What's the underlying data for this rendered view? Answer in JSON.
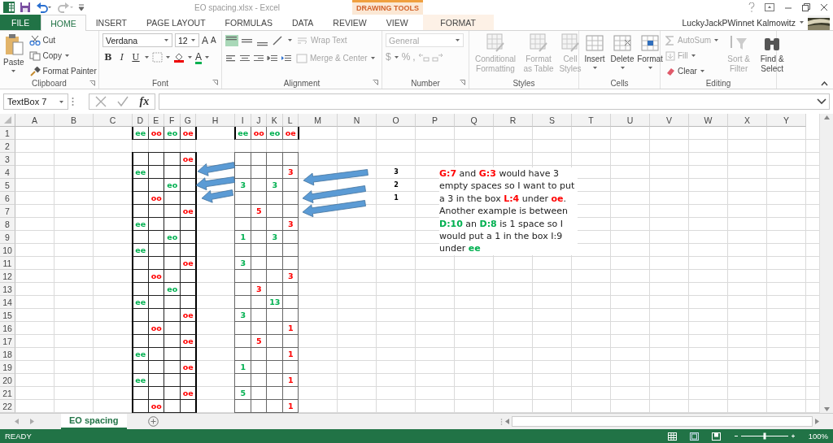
{
  "title_bar": {
    "title": "EO spacing.xlsx - Excel",
    "context_label": "DRAWING TOOLS"
  },
  "tabs": [
    {
      "label": "FILE",
      "kind": "file",
      "selected": false
    },
    {
      "label": "HOME",
      "kind": "normal",
      "selected": true
    },
    {
      "label": "INSERT",
      "kind": "normal",
      "selected": false
    },
    {
      "label": "PAGE LAYOUT",
      "kind": "normal",
      "selected": false
    },
    {
      "label": "FORMULAS",
      "kind": "normal",
      "selected": false
    },
    {
      "label": "DATA",
      "kind": "normal",
      "selected": false
    },
    {
      "label": "REVIEW",
      "kind": "normal",
      "selected": false
    },
    {
      "label": "VIEW",
      "kind": "normal",
      "selected": false
    },
    {
      "label": "FORMAT",
      "kind": "context",
      "selected": false
    }
  ],
  "user": {
    "name": "LuckyJackPWinnet Kalmowitz"
  },
  "ribbon": {
    "groups": [
      {
        "kind": "clipboard",
        "label": "Clipboard",
        "items": [
          {
            "label": "Paste"
          },
          {
            "label": "Cut"
          },
          {
            "label": "Copy"
          },
          {
            "label": "Format Painter"
          }
        ]
      },
      {
        "kind": "font",
        "label": "Font",
        "font": "Verdana",
        "size": "12",
        "size_buttons": [
          "A",
          "A"
        ],
        "styles": [
          "B",
          "I",
          "U"
        ],
        "font_color_label": "A"
      },
      {
        "kind": "alignment",
        "label": "Alignment",
        "items": [
          {
            "label": "Wrap Text",
            "disabled": true
          },
          {
            "label": "Merge & Center",
            "disabled": true
          }
        ]
      },
      {
        "kind": "number",
        "label": "Number",
        "format": "General",
        "symbols": [
          "$",
          "%",
          ","
        ],
        "disabled": true
      },
      {
        "kind": "styles",
        "label": "Styles",
        "items": [
          {
            "label": "Conditional Formatting",
            "disabled": true
          },
          {
            "label": "Format as Table",
            "disabled": true
          },
          {
            "label": "Cell Styles",
            "disabled": true
          }
        ]
      },
      {
        "kind": "cells",
        "label": "Cells",
        "items": [
          {
            "label": "Insert",
            "disabled": false
          },
          {
            "label": "Delete",
            "disabled": false
          },
          {
            "label": "Format",
            "disabled": false
          }
        ]
      },
      {
        "kind": "editing",
        "label": "Editing",
        "items": [
          {
            "label": "AutoSum",
            "disabled": true
          },
          {
            "label": "Fill",
            "disabled": true
          },
          {
            "label": "Clear",
            "disabled": false
          },
          {
            "label": "Sort & Filter",
            "disabled": true
          },
          {
            "label": "Find & Select",
            "disabled": false
          }
        ]
      }
    ]
  },
  "formula_bar": {
    "name_box": "TextBox 7",
    "function_label": "fx"
  },
  "sheet": {
    "columns": [
      "A",
      "B",
      "C",
      "D",
      "E",
      "F",
      "G",
      "H",
      "I",
      "J",
      "K",
      "L",
      "M",
      "N",
      "O",
      "P",
      "Q",
      "R",
      "S",
      "T",
      "U",
      "V",
      "W",
      "X",
      "Y"
    ],
    "rows": [
      {
        "number": "1",
        "cells": {
          "D": {
            "text": "ee",
            "color": "#00b050"
          },
          "E": {
            "text": "oo",
            "color": "#ff0000"
          },
          "F": {
            "text": "eo",
            "color": "#00b050"
          },
          "G": {
            "text": "oe",
            "color": "#ff0000"
          },
          "I": {
            "text": "ee",
            "color": "#00b050"
          },
          "J": {
            "text": "oo",
            "color": "#ff0000"
          },
          "K": {
            "text": "eo",
            "color": "#00b050"
          },
          "L": {
            "text": "oe",
            "color": "#ff0000"
          }
        }
      },
      {
        "number": "2",
        "cells": {}
      },
      {
        "number": "3",
        "cells": {
          "G": {
            "text": "oe",
            "color": "#ff0000"
          }
        }
      },
      {
        "number": "4",
        "cells": {
          "D": {
            "text": "ee",
            "color": "#00b050"
          },
          "L": {
            "text": "3",
            "color": "#ff0000"
          },
          "O": {
            "text": "3",
            "color": "#000000"
          }
        }
      },
      {
        "number": "5",
        "cells": {
          "F": {
            "text": "eo",
            "color": "#00b050"
          },
          "I": {
            "text": "3",
            "color": "#00b050"
          },
          "K": {
            "text": "3",
            "color": "#00b050"
          },
          "O": {
            "text": "2",
            "color": "#000000"
          }
        }
      },
      {
        "number": "6",
        "cells": {
          "E": {
            "text": "oo",
            "color": "#ff0000"
          },
          "O": {
            "text": "1",
            "color": "#000000"
          }
        }
      },
      {
        "number": "7",
        "cells": {
          "G": {
            "text": "oe",
            "color": "#ff0000"
          },
          "J": {
            "text": "5",
            "color": "#ff0000"
          }
        }
      },
      {
        "number": "8",
        "cells": {
          "D": {
            "text": "ee",
            "color": "#00b050"
          },
          "L": {
            "text": "3",
            "color": "#ff0000"
          }
        }
      },
      {
        "number": "9",
        "cells": {
          "F": {
            "text": "eo",
            "color": "#00b050"
          },
          "I": {
            "text": "1",
            "color": "#00b050"
          },
          "K": {
            "text": "3",
            "color": "#00b050"
          }
        }
      },
      {
        "number": "10",
        "cells": {
          "D": {
            "text": "ee",
            "color": "#00b050"
          }
        }
      },
      {
        "number": "11",
        "cells": {
          "G": {
            "text": "oe",
            "color": "#ff0000"
          },
          "I": {
            "text": "3",
            "color": "#00b050"
          }
        }
      },
      {
        "number": "12",
        "cells": {
          "E": {
            "text": "oo",
            "color": "#ff0000"
          },
          "L": {
            "text": "3",
            "color": "#ff0000"
          }
        }
      },
      {
        "number": "13",
        "cells": {
          "F": {
            "text": "eo",
            "color": "#00b050"
          },
          "J": {
            "text": "3",
            "color": "#ff0000"
          }
        }
      },
      {
        "number": "14",
        "cells": {
          "D": {
            "text": "ee",
            "color": "#00b050"
          },
          "K": {
            "text": "13",
            "color": "#00b050"
          }
        }
      },
      {
        "number": "15",
        "cells": {
          "G": {
            "text": "oe",
            "color": "#ff0000"
          },
          "I": {
            "text": "3",
            "color": "#00b050"
          }
        }
      },
      {
        "number": "16",
        "cells": {
          "E": {
            "text": "oo",
            "color": "#ff0000"
          },
          "L": {
            "text": "1",
            "color": "#ff0000"
          }
        }
      },
      {
        "number": "17",
        "cells": {
          "G": {
            "text": "oe",
            "color": "#ff0000"
          },
          "J": {
            "text": "5",
            "color": "#ff0000"
          }
        }
      },
      {
        "number": "18",
        "cells": {
          "D": {
            "text": "ee",
            "color": "#00b050"
          },
          "L": {
            "text": "1",
            "color": "#ff0000"
          }
        }
      },
      {
        "number": "19",
        "cells": {
          "G": {
            "text": "oe",
            "color": "#ff0000"
          },
          "I": {
            "text": "1",
            "color": "#00b050"
          }
        }
      },
      {
        "number": "20",
        "cells": {
          "D": {
            "text": "ee",
            "color": "#00b050"
          },
          "L": {
            "text": "1",
            "color": "#ff0000"
          }
        }
      },
      {
        "number": "21",
        "cells": {
          "G": {
            "text": "oe",
            "color": "#ff0000"
          },
          "I": {
            "text": "5",
            "color": "#00b050"
          }
        }
      },
      {
        "number": "22",
        "cells": {
          "E": {
            "text": "oo",
            "color": "#ff0000"
          },
          "L": {
            "text": "1",
            "color": "#ff0000"
          }
        }
      }
    ]
  },
  "text_box": {
    "segments": [
      {
        "text": "G:7",
        "color": "#ff0000"
      },
      {
        "text": " and "
      },
      {
        "text": "G:3",
        "color": "#ff0000"
      },
      {
        "text": " would have 3 empty spaces so I want to put a 3 in the box "
      },
      {
        "text": "L:4",
        "color": "#ff0000"
      },
      {
        "text": " under "
      },
      {
        "text": "oe",
        "color": "#ff0000"
      },
      {
        "text": ".  Another example is between "
      },
      {
        "text": "D:10",
        "color": "#00b050"
      },
      {
        "text": " an "
      },
      {
        "text": "D:8",
        "color": "#00b050"
      },
      {
        "text": " is 1 space so I would put a 1 in the box I:9 under "
      },
      {
        "text": "ee",
        "color": "#00b050"
      }
    ]
  },
  "sheet_tabs": [
    {
      "label": "EO spacing",
      "selected": true
    }
  ],
  "status_bar": {
    "status": "READY",
    "zoom_slider": {
      "level": 0.5
    },
    "zoom": "100%"
  }
}
